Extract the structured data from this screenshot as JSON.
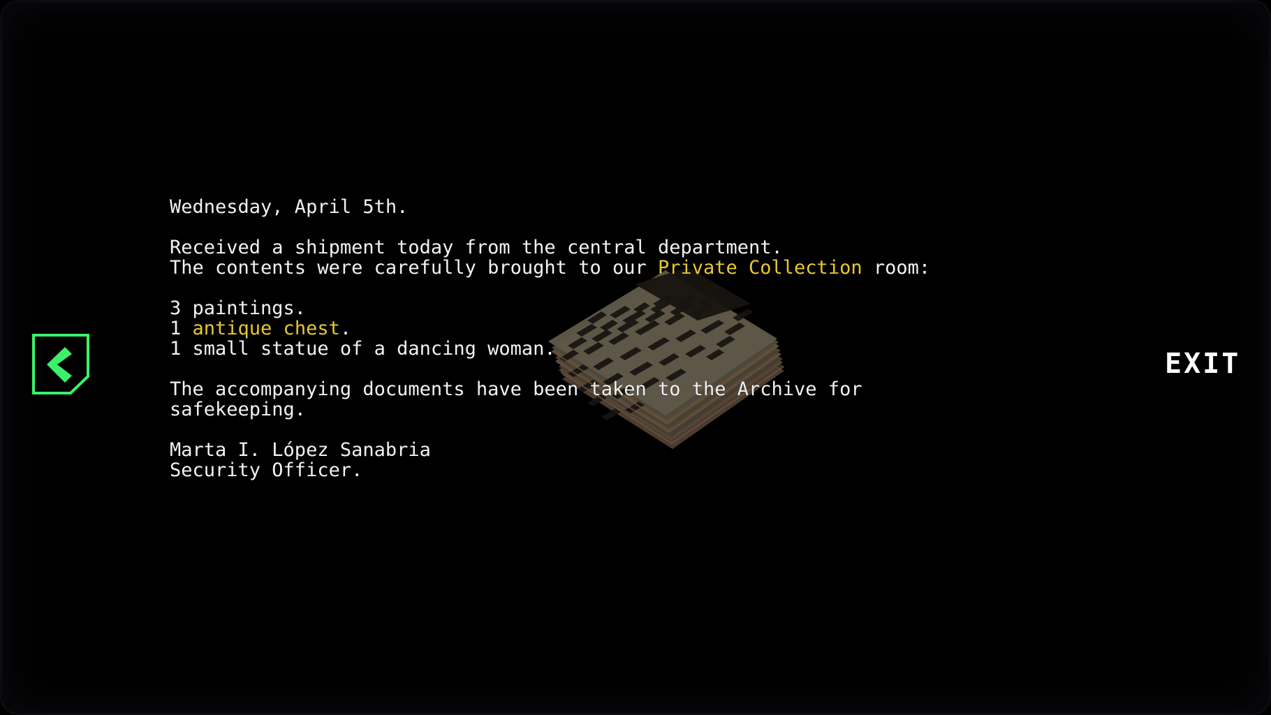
{
  "screen": {
    "background_color": "#000000",
    "frame_color": "#17171d"
  },
  "note": {
    "text_color": "#f2f2f2",
    "highlight_color": "#e9c82e",
    "lines": [
      {
        "type": "text",
        "segments": [
          {
            "text": "Wednesday, April 5th.",
            "highlight": false
          }
        ]
      },
      {
        "type": "blank"
      },
      {
        "type": "text",
        "segments": [
          {
            "text": "Received a shipment today from the central department.",
            "highlight": false
          }
        ]
      },
      {
        "type": "text",
        "segments": [
          {
            "text": "The contents were carefully brought to our ",
            "highlight": false
          },
          {
            "text": "Private Collection",
            "highlight": true
          },
          {
            "text": " room:",
            "highlight": false
          }
        ]
      },
      {
        "type": "blank"
      },
      {
        "type": "text",
        "segments": [
          {
            "text": "3 paintings.",
            "highlight": false
          }
        ]
      },
      {
        "type": "text",
        "segments": [
          {
            "text": "1 ",
            "highlight": false
          },
          {
            "text": "antique chest",
            "highlight": true
          },
          {
            "text": ".",
            "highlight": false
          }
        ]
      },
      {
        "type": "text",
        "segments": [
          {
            "text": "1 small statue of a dancing woman.",
            "highlight": false
          }
        ]
      },
      {
        "type": "blank"
      },
      {
        "type": "text",
        "segments": [
          {
            "text": "The accompanying documents have been taken to the Archive for",
            "highlight": false
          }
        ]
      },
      {
        "type": "text",
        "segments": [
          {
            "text": "safekeeping.",
            "highlight": false
          }
        ]
      },
      {
        "type": "blank"
      },
      {
        "type": "text",
        "segments": [
          {
            "text": "Marta I. López Sanabria",
            "highlight": false
          }
        ]
      },
      {
        "type": "text",
        "segments": [
          {
            "text": "Security Officer.",
            "highlight": false
          }
        ]
      }
    ]
  },
  "controls": {
    "back": {
      "icon": "chevron-left-icon",
      "color": "#3bf06a"
    },
    "exit": {
      "label": "EXIT",
      "color": "#ffffff"
    }
  },
  "artwork": {
    "name": "stack-of-papers",
    "paper_color": "#4a463c",
    "paper_shade_color": "#3b382f",
    "paper_edge_color": "#5c4a3c",
    "ink_color": "#1a1712",
    "title_bar_color": "#17140f"
  }
}
